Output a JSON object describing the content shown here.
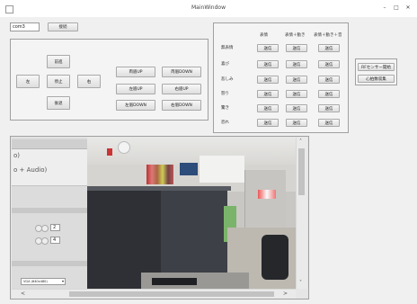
{
  "window": {
    "title": "MainWindow",
    "minimize": "–",
    "maximize": "□",
    "close": "✕"
  },
  "connection": {
    "port_value": "com3",
    "connect_label": "接続"
  },
  "movement": {
    "forward": "前進",
    "left": "左",
    "stop": "停止",
    "right": "右",
    "backward": "後退"
  },
  "head": {
    "both_up": "両眉UP",
    "both_down": "両眉DOWN",
    "left_up": "左眉UP",
    "right_up": "右眉UP",
    "left_down": "左眉DOWN",
    "right_down": "右眉DOWN"
  },
  "expressions": {
    "columns": [
      "表情",
      "表情＋動き",
      "表情＋動き＋音"
    ],
    "rows": [
      {
        "label": "無表情",
        "cells": [
          "送信",
          "送信",
          "送信"
        ]
      },
      {
        "label": "喜び",
        "cells": [
          "送信",
          "送信",
          "送信"
        ]
      },
      {
        "label": "悲しみ",
        "cells": [
          "送信",
          "送信",
          "送信"
        ]
      },
      {
        "label": "怒り",
        "cells": [
          "送信",
          "送信",
          "送信"
        ]
      },
      {
        "label": "驚き",
        "cells": [
          "送信",
          "送信",
          "送信"
        ]
      },
      {
        "label": "恐れ",
        "cells": [
          "送信",
          "送信",
          "送信"
        ]
      }
    ]
  },
  "sensor": {
    "start_label": "RFセンサー開始",
    "heart_label": "心拍数収集"
  },
  "camera": {
    "audio_text_1": "o)",
    "audio_text_2": "o + Audio)",
    "spin_1": "2",
    "spin_2": "4",
    "resolution": "VGA (640x480)",
    "scroll_left": "<",
    "scroll_right": ">",
    "scroll_up": "˄",
    "scroll_down": "˅"
  }
}
